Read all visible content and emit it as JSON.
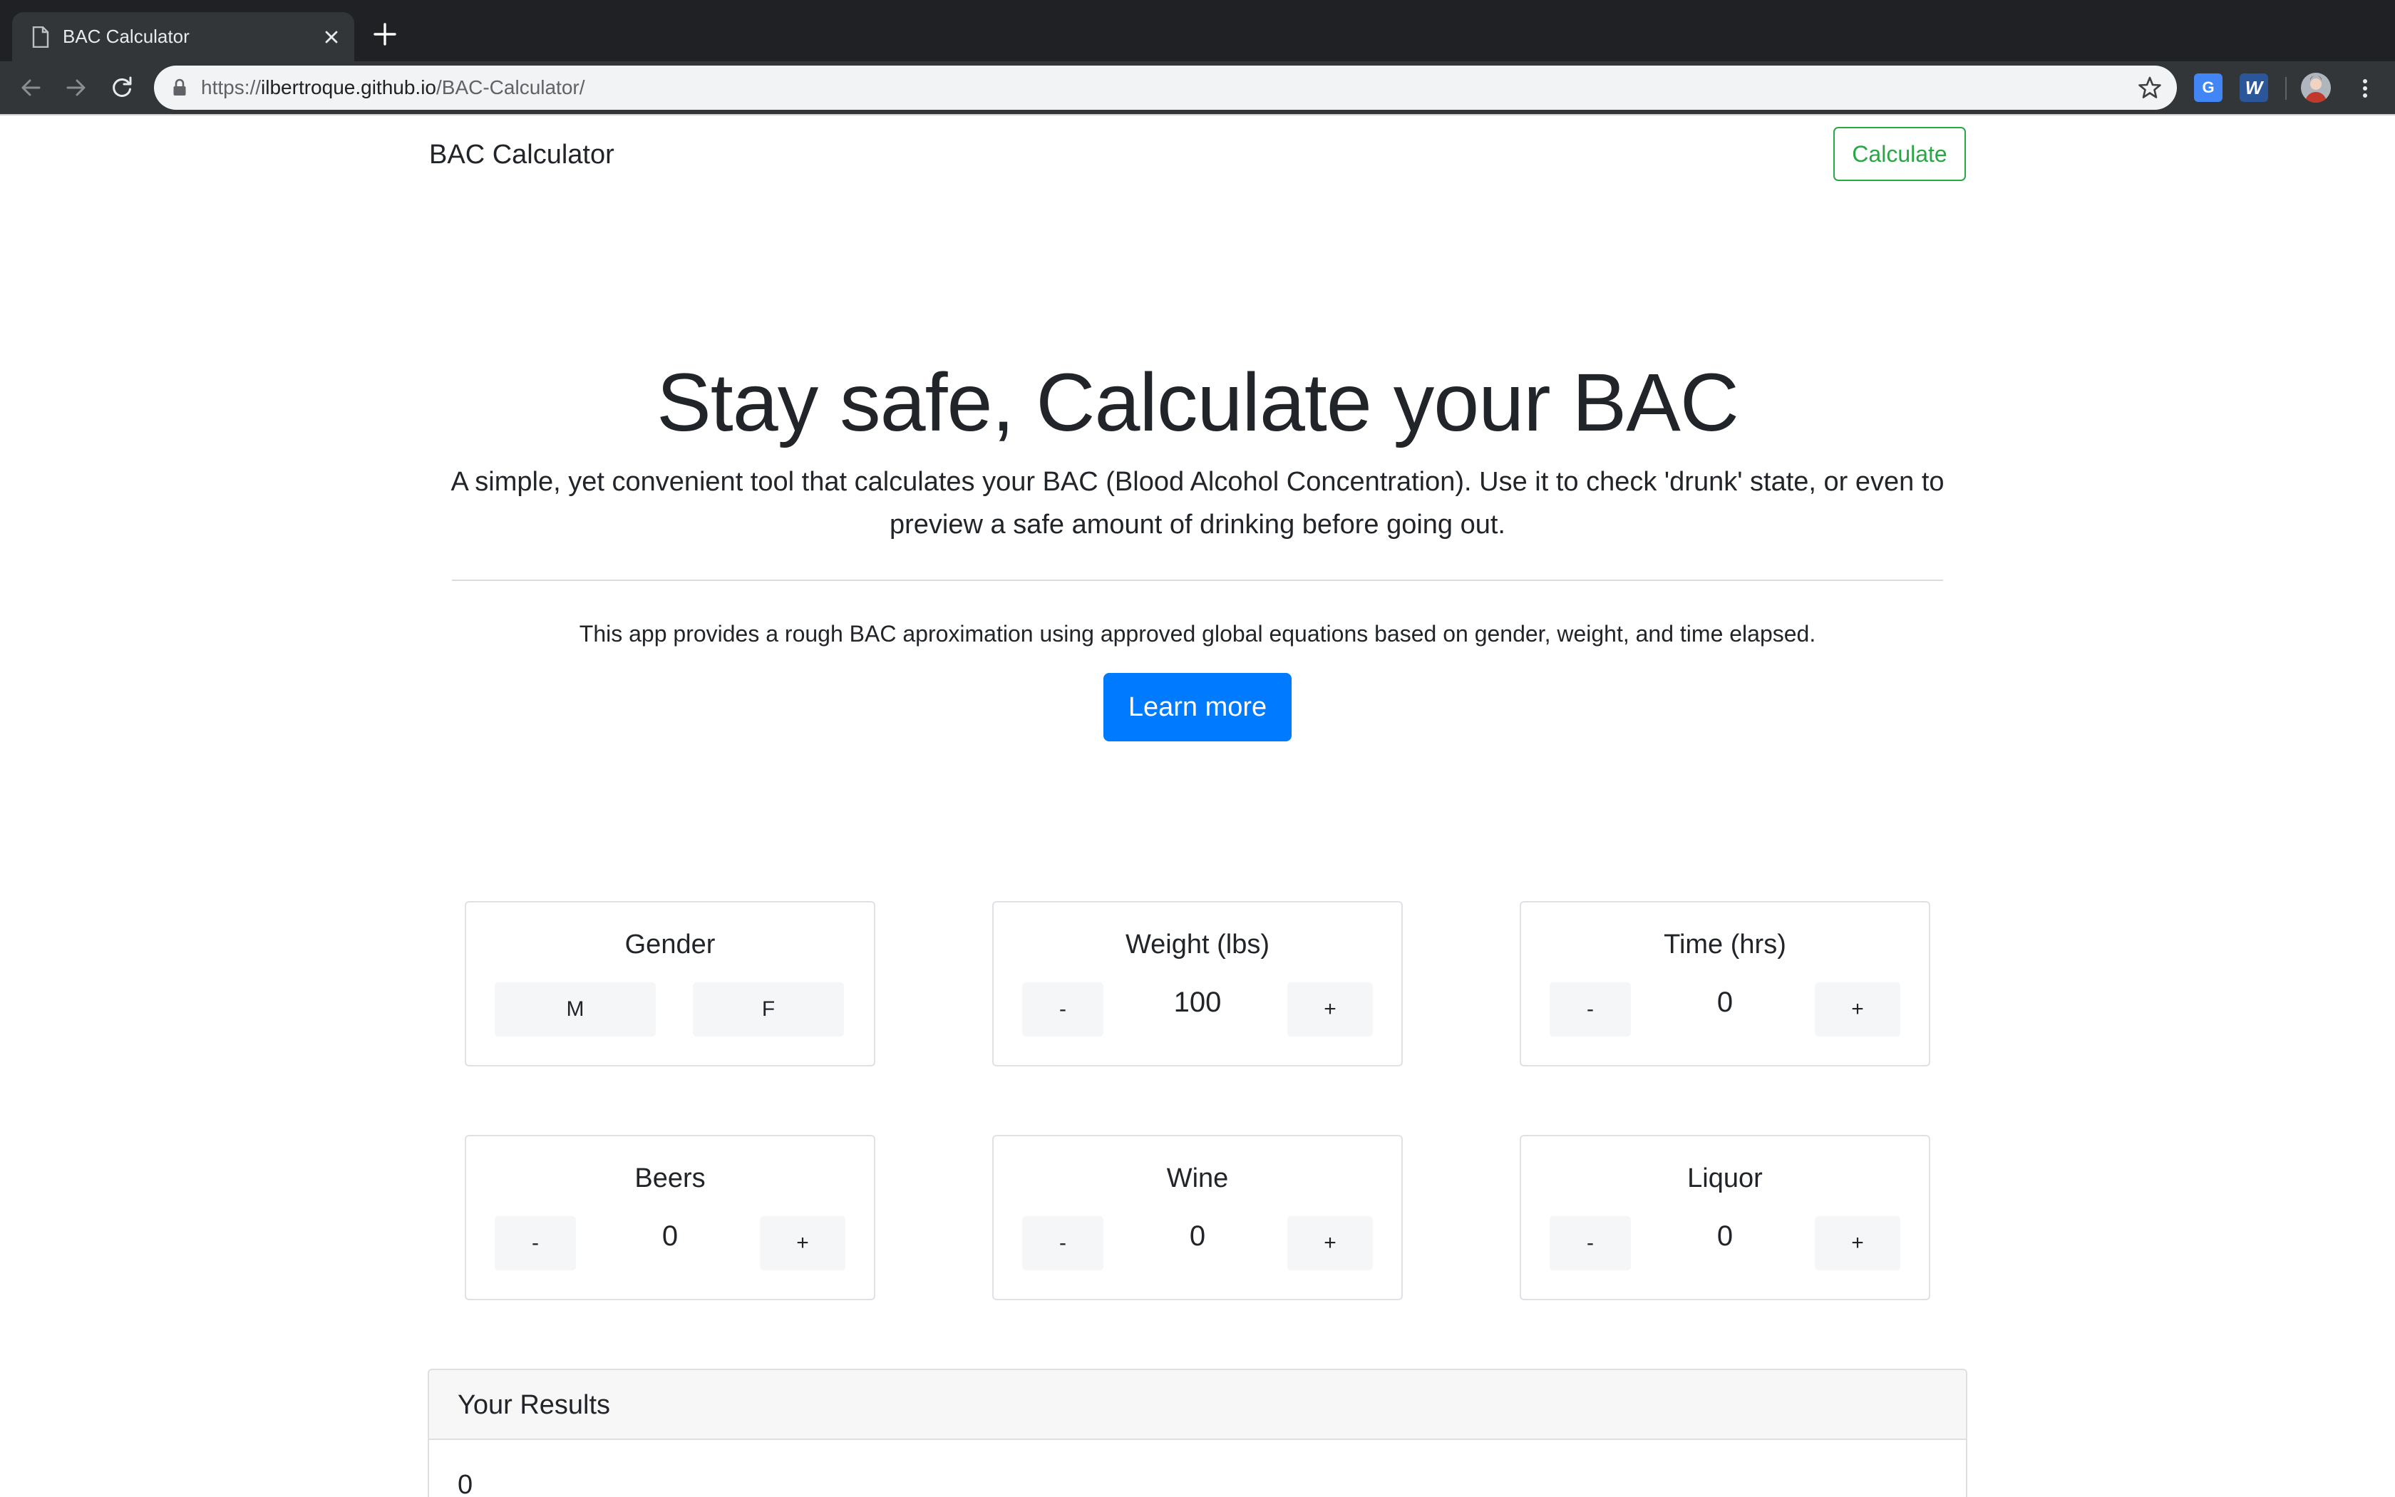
{
  "browser": {
    "tab_title": "BAC Calculator",
    "url_scheme": "https://",
    "url_host": "ilbertroque.github.io",
    "url_path": "/BAC-Calculator/",
    "icons": [
      "page-icon",
      "close-icon",
      "plus-icon",
      "back-icon",
      "forward-icon",
      "reload-icon",
      "lock-icon",
      "star-icon",
      "translate-icon",
      "word-icon",
      "avatar",
      "kebab-menu-icon"
    ]
  },
  "navbar": {
    "brand": "BAC Calculator",
    "calculate_label": "Calculate",
    "accent_color": "#28a745"
  },
  "hero": {
    "title": "Stay safe, Calculate your BAC",
    "lead": "A simple, yet convenient tool that calculates your BAC (Blood Alcohol Concentration). Use it to check 'drunk' state, or even to preview a safe amount of drinking before going out.",
    "note": "This app provides a rough BAC aproximation using approved global equations based on gender, weight, and time elapsed.",
    "learn_more_label": "Learn more",
    "button_color": "#007bff"
  },
  "cards": {
    "gender": {
      "title": "Gender",
      "option_m": "M",
      "option_f": "F"
    },
    "weight": {
      "title": "Weight (lbs)",
      "value": "100",
      "minus": "-",
      "plus": "+"
    },
    "time": {
      "title": "Time (hrs)",
      "value": "0",
      "minus": "-",
      "plus": "+"
    },
    "beers": {
      "title": "Beers",
      "value": "0",
      "minus": "-",
      "plus": "+"
    },
    "wine": {
      "title": "Wine",
      "value": "0",
      "minus": "-",
      "plus": "+"
    },
    "liquor": {
      "title": "Liquor",
      "value": "0",
      "minus": "-",
      "plus": "+"
    }
  },
  "results": {
    "header": "Your Results",
    "value": "0"
  }
}
